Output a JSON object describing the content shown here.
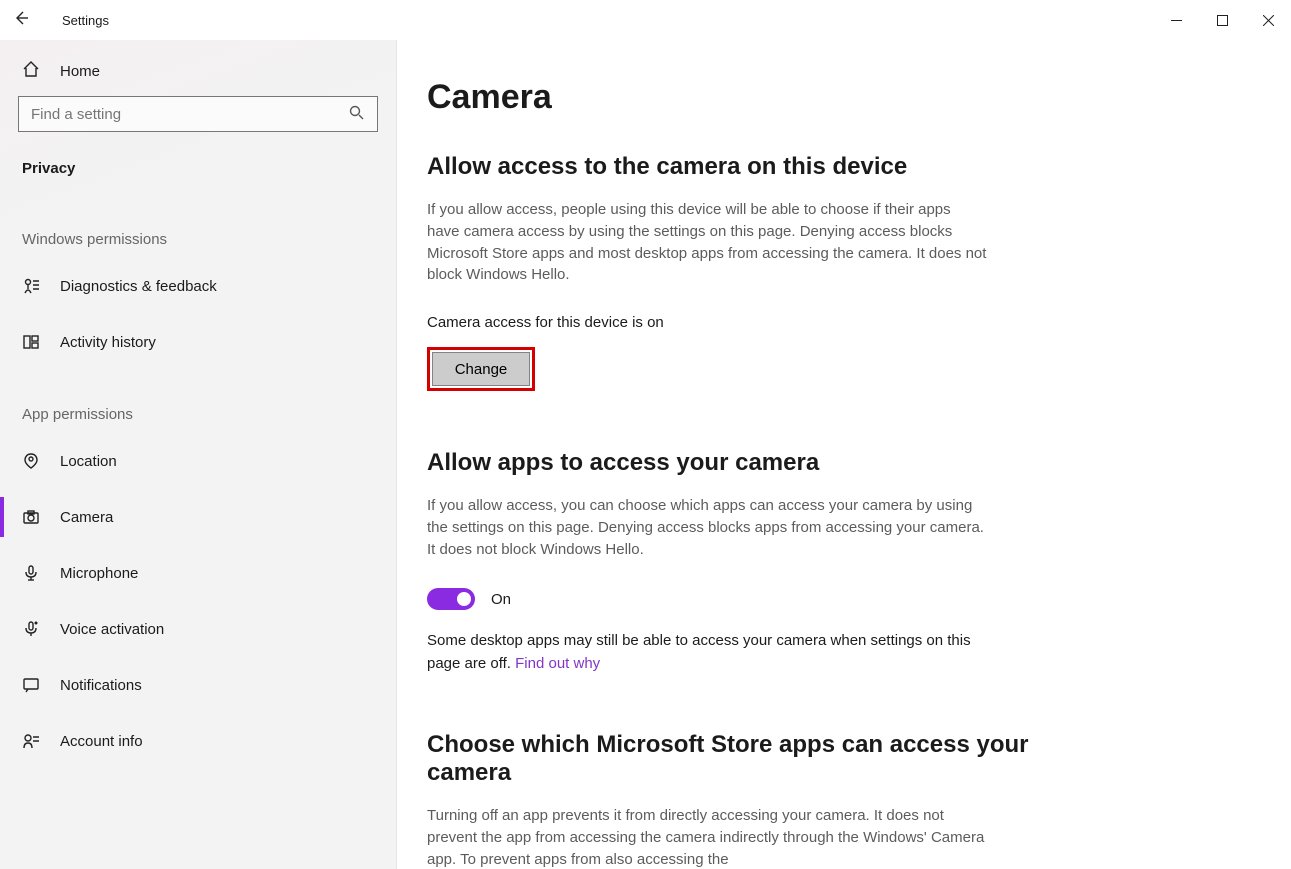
{
  "titlebar": {
    "title": "Settings"
  },
  "sidebar": {
    "home_label": "Home",
    "search_placeholder": "Find a setting",
    "category_label": "Privacy",
    "sections": {
      "windows_permissions": "Windows permissions",
      "app_permissions": "App permissions"
    },
    "win_items": [
      {
        "label": "Diagnostics & feedback"
      },
      {
        "label": "Activity history"
      }
    ],
    "app_items": [
      {
        "label": "Location"
      },
      {
        "label": "Camera"
      },
      {
        "label": "Microphone"
      },
      {
        "label": "Voice activation"
      },
      {
        "label": "Notifications"
      },
      {
        "label": "Account info"
      }
    ]
  },
  "main": {
    "page_title": "Camera",
    "section1": {
      "heading": "Allow access to the camera on this device",
      "body": "If you allow access, people using this device will be able to choose if their apps have camera access by using the settings on this page. Denying access blocks Microsoft Store apps and most desktop apps from accessing the camera. It does not block Windows Hello.",
      "status": "Camera access for this device is on",
      "change_label": "Change"
    },
    "section2": {
      "heading": "Allow apps to access your camera",
      "body": "If you allow access, you can choose which apps can access your camera by using the settings on this page. Denying access blocks apps from accessing your camera. It does not block Windows Hello.",
      "toggle_label": "On",
      "note_prefix": "Some desktop apps may still be able to access your camera when settings on this page are off. ",
      "note_link": "Find out why"
    },
    "section3": {
      "heading": "Choose which Microsoft Store apps can access your camera",
      "body": "Turning off an app prevents it from directly accessing your camera. It does not prevent the app from accessing the camera indirectly through the Windows' Camera app. To prevent apps from also accessing the"
    }
  }
}
